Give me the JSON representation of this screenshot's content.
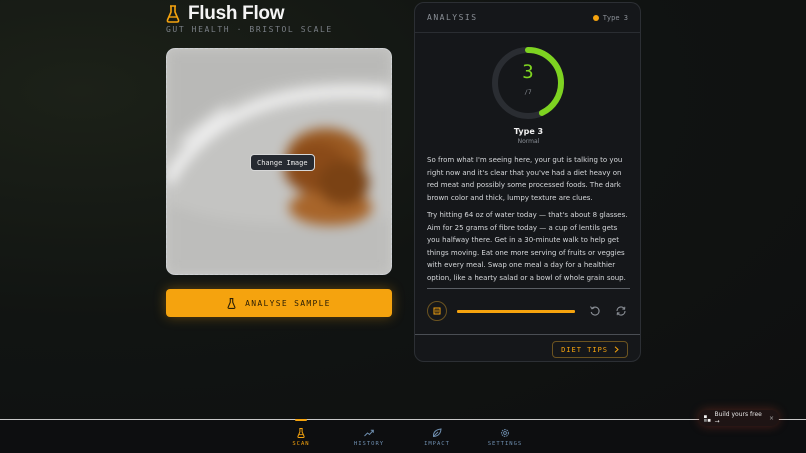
{
  "app": {
    "title": "Flush Flow",
    "subtitle": "GUT HEALTH · BRISTOL SCALE",
    "icon": "flask-icon"
  },
  "scan": {
    "change_image_label": "Change Image",
    "analyse_label": "ANALYSE SAMPLE"
  },
  "analysis": {
    "header_label": "ANALYSIS",
    "type_pill": "Type 3",
    "score": "3",
    "score_max": "/7",
    "score_fraction": 0.43,
    "result_title": "Type 3",
    "result_subtitle": "Normal",
    "paragraph_1": "So from what I'm seeing here, your gut is talking to you right now and it's clear that you've had a diet heavy on red meat and possibly some processed foods. The dark brown color and thick, lumpy texture are clues.",
    "paragraph_2": "Try hitting 64 oz of water today — that's about 8 glasses. Aim for 25 grams of fibre today — a cup of lentils gets you halfway there. Get in a 30-minute walk to help get things moving. Eat one more serving of fruits or veggies with every meal. Swap one meal a day for a healthier option, like a hearty salad or a bowl of whole grain soup.",
    "audio_progress": 1.0,
    "diet_tips_label": "DIET TIPS"
  },
  "nav": {
    "items": [
      {
        "label": "SCAN",
        "icon": "flask-icon",
        "active": true
      },
      {
        "label": "HISTORY",
        "icon": "trend-icon",
        "active": false
      },
      {
        "label": "IMPACT",
        "icon": "leaf-icon",
        "active": false
      },
      {
        "label": "SETTINGS",
        "icon": "gear-icon",
        "active": false
      }
    ]
  },
  "badge": {
    "label": "Build yours free →",
    "close": "×"
  },
  "colors": {
    "accent": "#f5a30e",
    "gauge": "#7ed321",
    "nav_inactive": "#6f8fb0"
  }
}
